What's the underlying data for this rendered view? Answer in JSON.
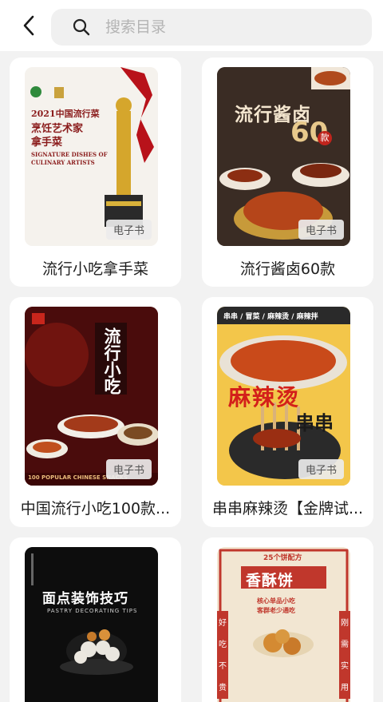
{
  "search": {
    "placeholder": "搜索目录"
  },
  "icons": {
    "back": "chevron-left-icon",
    "search": "search-icon"
  },
  "books": [
    {
      "title": "流行小吃拿手菜",
      "tag": "电子书",
      "cover": {
        "year_title": "2021中国流行菜",
        "heading": "烹饪艺术家拿手菜",
        "heading_l1": "烹饪艺术家",
        "heading_l2": "拿手菜",
        "subtitle_l1": "SIGNATURE DISHES OF",
        "subtitle_l2": "CULINARY ARTISTS"
      }
    },
    {
      "title": "流行酱卤60款",
      "tag": "电子书",
      "cover": {
        "heading": "流行酱卤",
        "number": "60",
        "badge": "款"
      }
    },
    {
      "title": "中国流行小吃100款...",
      "tag": "电子书",
      "cover": {
        "heading": "流行小吃",
        "footer": "100 POPULAR CHINESE SNACKS"
      }
    },
    {
      "title": "串串麻辣烫【金牌试...",
      "tag": "电子书",
      "cover": {
        "categories": "串串 / 冒菜 / 麻辣烫 / 麻辣拌",
        "heading": "麻辣烫",
        "subheading": "串串"
      }
    },
    {
      "title": "",
      "cover": {
        "heading": "面点装饰技巧",
        "subtitle": "PASTRY DECORATING TIPS"
      }
    },
    {
      "title": "",
      "cover": {
        "top_banner": "25个饼配方",
        "heading": "香酥饼",
        "left_column": [
          "好",
          "吃",
          "不",
          "贵"
        ],
        "right_column": [
          "刚",
          "需",
          "实",
          "用"
        ],
        "tagline_l1": "核心单品小吃",
        "tagline_l2": "客群老少通吃"
      }
    }
  ]
}
